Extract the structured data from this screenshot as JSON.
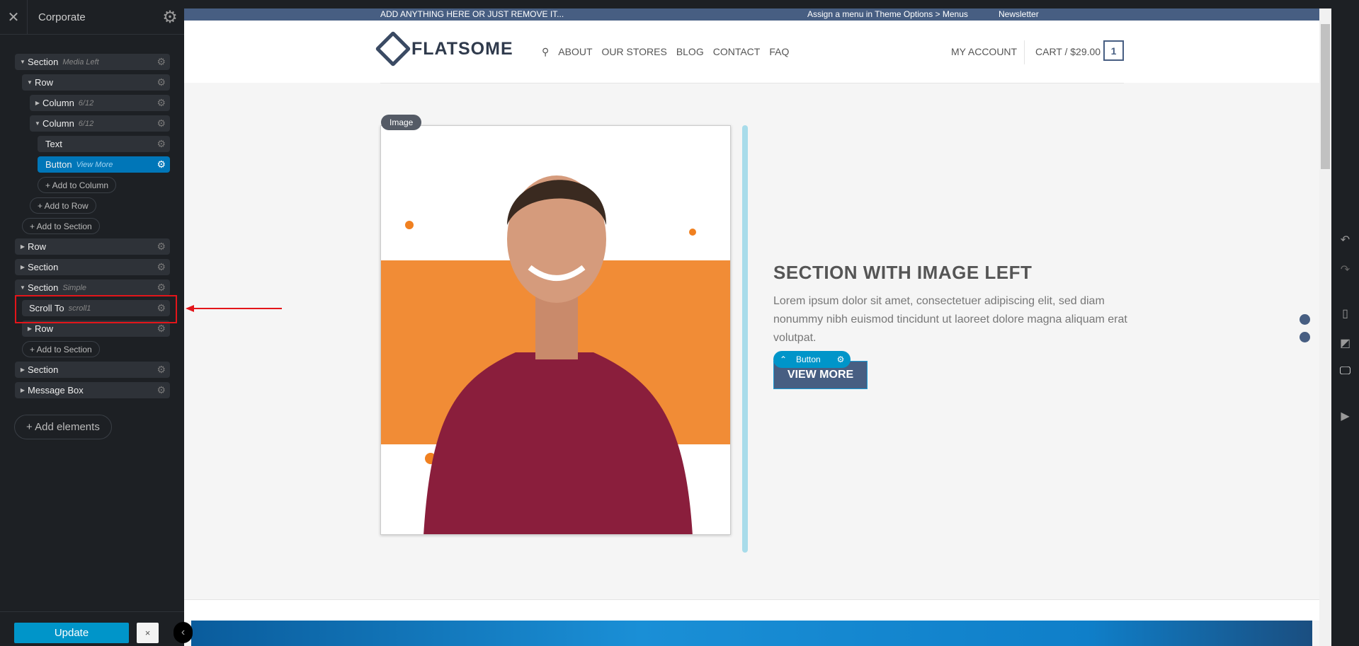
{
  "sidebar": {
    "title": "Corporate",
    "tree": [
      {
        "label": "Section",
        "sub": "Media Left"
      },
      {
        "label": "Row",
        "sub": ""
      },
      {
        "label": "Column",
        "sub": "6/12"
      },
      {
        "label": "Column",
        "sub": "6/12"
      },
      {
        "label": "Text",
        "sub": ""
      },
      {
        "label": "Button",
        "sub": "View More"
      },
      {
        "label": "Row",
        "sub": ""
      },
      {
        "label": "Section",
        "sub": ""
      },
      {
        "label": "Section",
        "sub": "Simple"
      },
      {
        "label": "Scroll To",
        "sub": "scroll1"
      },
      {
        "label": "Row",
        "sub": ""
      },
      {
        "label": "Section",
        "sub": ""
      },
      {
        "label": "Message Box",
        "sub": ""
      }
    ],
    "add_to_column": "+ Add to Column",
    "add_to_row": "+ Add to Row",
    "add_to_section": "+ Add to Section",
    "add_elements": "+ Add elements",
    "update": "Update",
    "discard": "×"
  },
  "site": {
    "topbar_left": "ADD ANYTHING HERE OR JUST REMOVE IT...",
    "topbar_right": "Assign a menu in Theme Options > Menus",
    "newsletter": "Newsletter",
    "logo": "FLATSOME",
    "nav": [
      "ABOUT",
      "OUR STORES",
      "BLOG",
      "CONTACT",
      "FAQ"
    ],
    "account": "MY ACCOUNT",
    "cart": "CART / $29.00",
    "cart_count": "1",
    "image_badge": "Image",
    "heading": "SECTION WITH IMAGE LEFT",
    "paragraph": "Lorem ipsum dolor sit amet, consectetuer adipiscing elit, sed diam nonummy nibh euismod tincidunt ut laoreet dolore magna aliquam erat volutpat.",
    "button_tag": "Button",
    "button": "VIEW MORE",
    "brand_color": "#475e82",
    "accent": "#0095c9"
  }
}
